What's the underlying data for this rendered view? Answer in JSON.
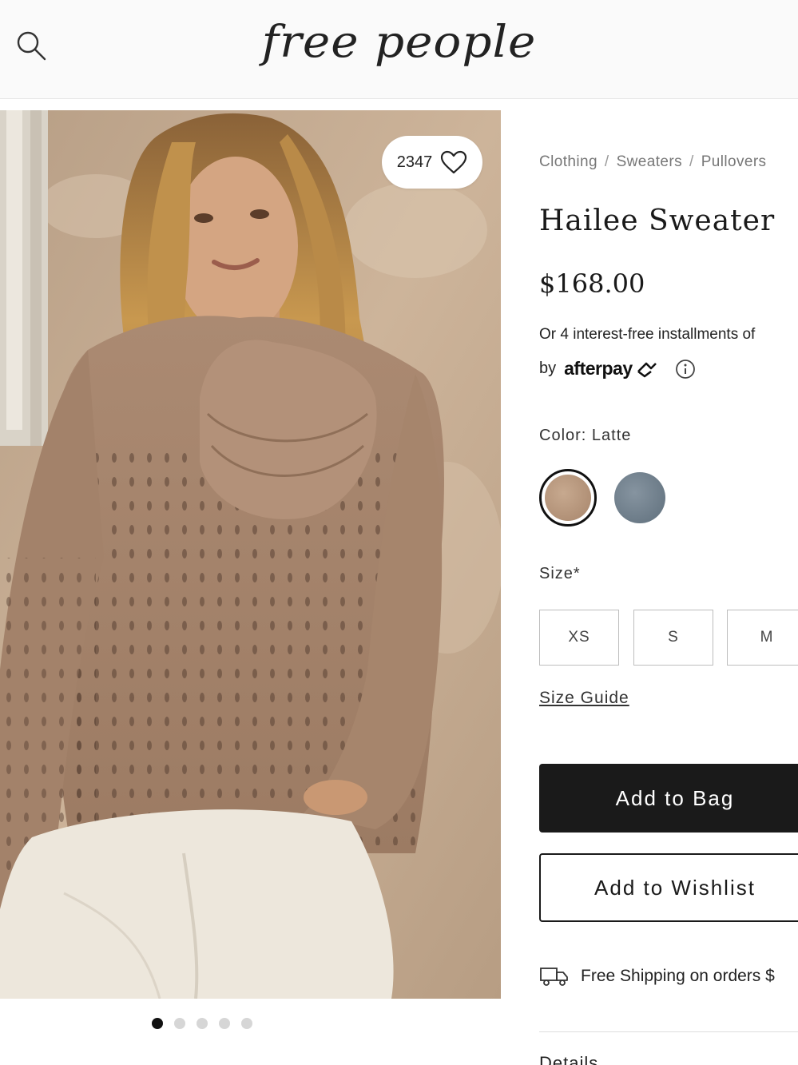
{
  "header": {
    "logo_text": "free people",
    "search_icon": "search-icon"
  },
  "gallery": {
    "like_count": "2347",
    "like_icon": "heart-icon",
    "dots_count": 5,
    "active_dot": 1
  },
  "product": {
    "breadcrumb": [
      "Clothing",
      "Sweaters",
      "Pullovers"
    ],
    "title": "Hailee Sweater",
    "price": "$168.00",
    "installments_text": "Or 4 interest-free installments of",
    "afterpay_by": "by",
    "afterpay_logo": "afterpay",
    "color_label": "Color: Latte",
    "swatches": [
      {
        "name": "Latte",
        "color": "#b8957a",
        "selected": true
      },
      {
        "name": "Blue",
        "color": "#6f7f8d",
        "selected": false
      }
    ],
    "size_label": "Size*",
    "sizes": [
      "XS",
      "S",
      "M"
    ],
    "size_guide_label": "Size Guide",
    "add_to_bag_label": "Add to Bag",
    "add_to_wishlist_label": "Add to Wishlist",
    "shipping_text": "Free Shipping on orders $",
    "details_label": "Details"
  },
  "colors": {
    "primary_button": "#1a1a1a",
    "muted_text": "#777777",
    "border": "#bdbdbd"
  }
}
